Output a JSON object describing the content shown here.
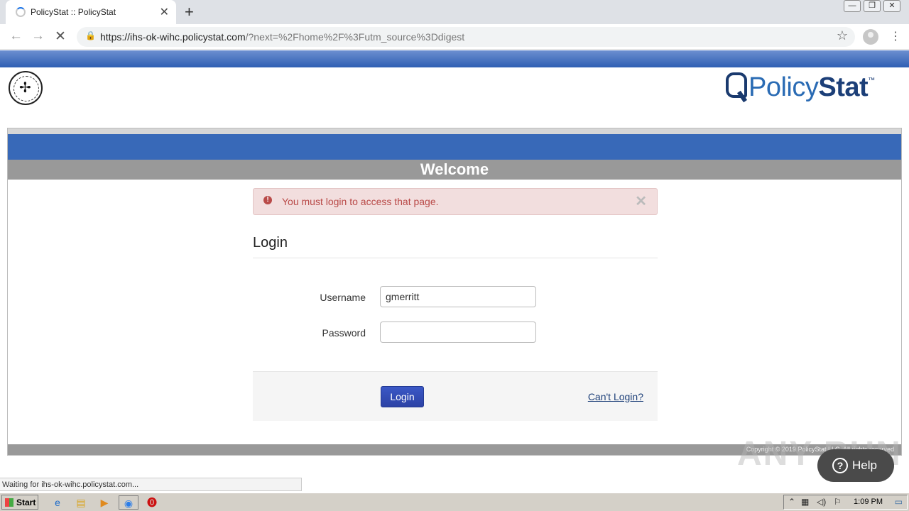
{
  "browser": {
    "tab_title": "PolicyStat :: PolicyStat",
    "tab_close": "✕",
    "new_tab": "+",
    "url_host": "https://ihs-ok-wihc.policystat.com",
    "url_rest": "/?next=%2Fhome%2F%3Futm_source%3Ddigest",
    "status_text": "Waiting for ihs-ok-wihc.policystat.com..."
  },
  "header": {
    "brand_left": "Policy",
    "brand_right": "Stat",
    "brand_tm": "™"
  },
  "page": {
    "welcome": "Welcome",
    "alert_message": "You must login to access that page.",
    "alert_close": "✕",
    "login_heading": "Login",
    "username_label": "Username",
    "username_value": "gmerritt",
    "password_label": "Password",
    "password_value": "",
    "login_button": "Login",
    "cant_login": "Can't Login?",
    "copyright": "Copyright © 2019 PolicyStat LLC. All rights reserved"
  },
  "overlay": {
    "help_label": "Help",
    "watermark": "ANY RUN"
  },
  "taskbar": {
    "start_label": "Start",
    "clock": "1:09 PM"
  }
}
